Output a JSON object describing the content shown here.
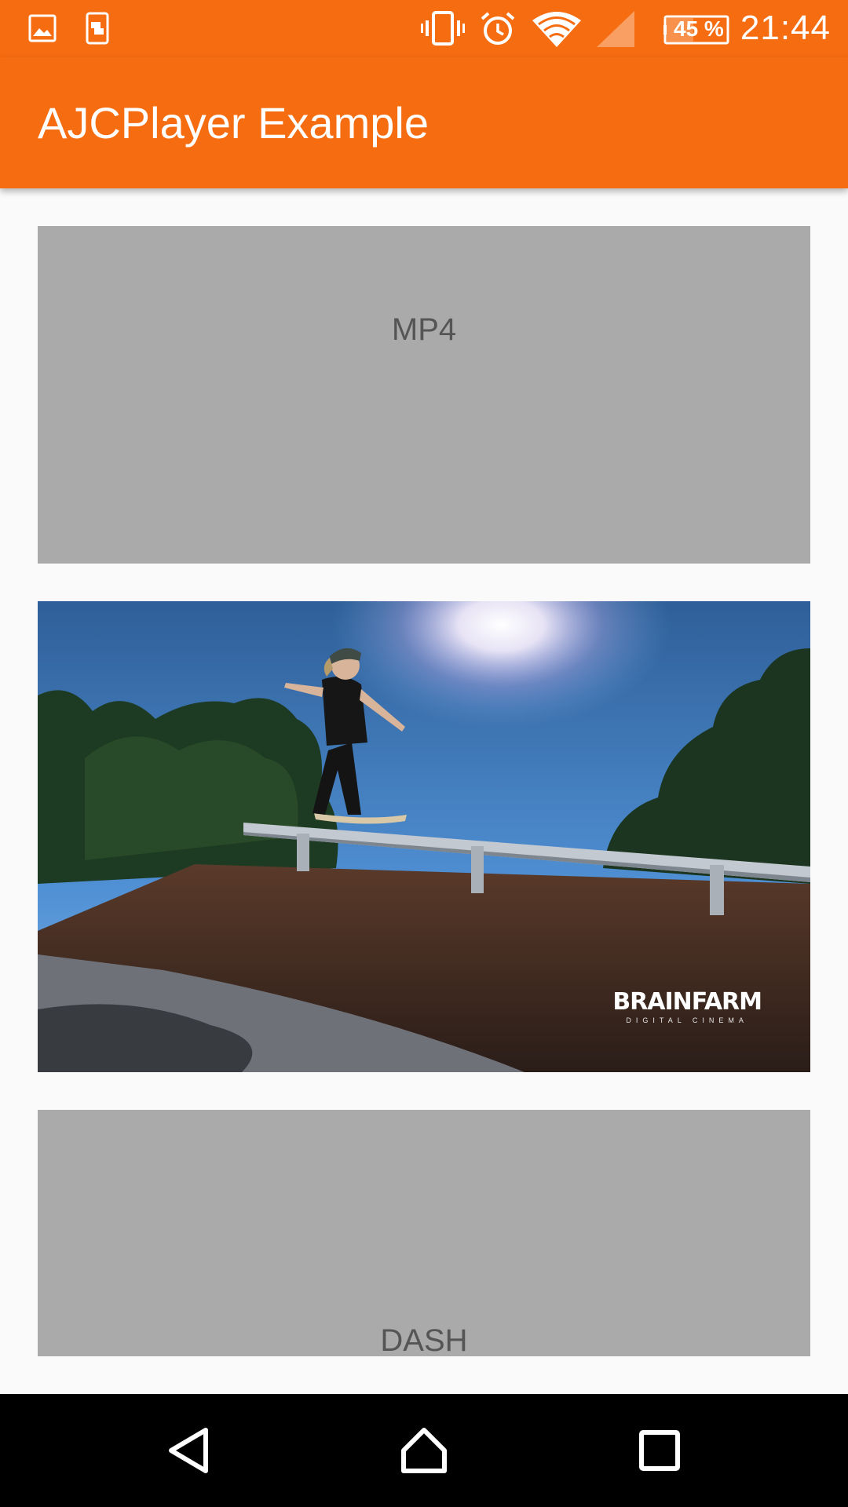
{
  "status_bar": {
    "time": "21:44",
    "battery": "45 %",
    "icons": [
      "image-icon",
      "screen-cast-icon",
      "vibrate-icon",
      "alarm-icon",
      "wifi-icon",
      "signal-icon",
      "battery-icon"
    ]
  },
  "app_bar": {
    "title": "AJCPlayer Example"
  },
  "videos": [
    {
      "label": "MP4"
    },
    {
      "watermark_main": "BRAINFARM",
      "watermark_sub": "DIGITAL CINEMA"
    },
    {
      "label": "DASH"
    }
  ],
  "nav_bar": {
    "icons": [
      "back-icon",
      "home-icon",
      "recents-icon"
    ]
  },
  "colors": {
    "accent": "#f66c11",
    "placeholder": "#aaaaaa",
    "background": "#fafafa"
  }
}
